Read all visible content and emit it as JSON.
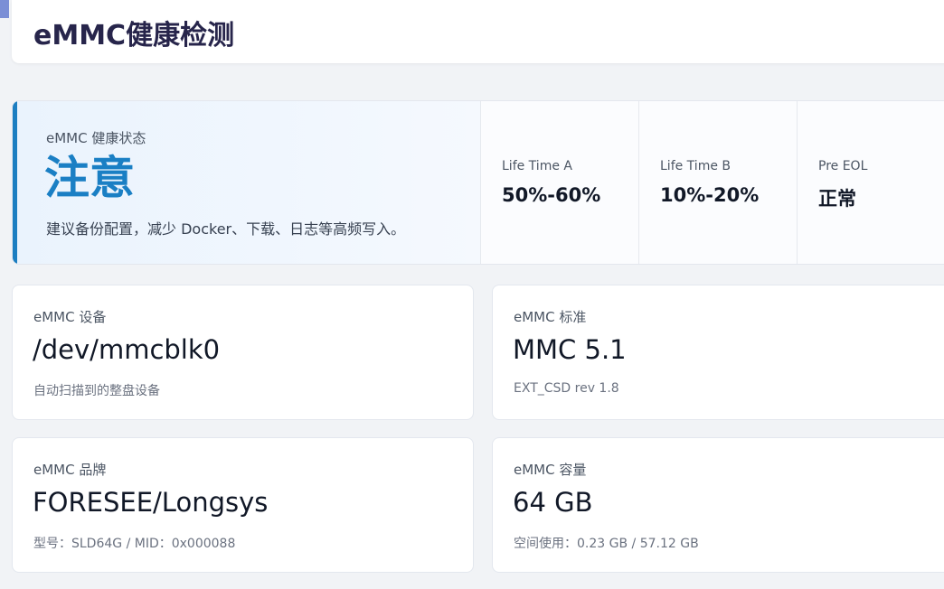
{
  "header": {
    "title": "eMMC健康检测"
  },
  "status": {
    "label": "eMMC 健康状态",
    "value": "注意",
    "description": "建议备份配置，减少 Docker、下载、日志等高频写入。",
    "metrics": [
      {
        "label": "Life Time A",
        "value": "50%-60%"
      },
      {
        "label": "Life Time B",
        "value": "10%-20%"
      },
      {
        "label": "Pre EOL",
        "value": "正常"
      }
    ]
  },
  "cards": [
    {
      "label": "eMMC 设备",
      "value": "/dev/mmcblk0",
      "sub": "自动扫描到的整盘设备"
    },
    {
      "label": "eMMC 标准",
      "value": "MMC 5.1",
      "sub": "EXT_CSD rev 1.8"
    },
    {
      "label": "eMMC 品牌",
      "value": "FORESEE/Longsys",
      "sub": "型号：SLD64G / MID：0x000088"
    },
    {
      "label": "eMMC 容量",
      "value": "64 GB",
      "sub": "空间使用：0.23 GB / 57.12 GB"
    }
  ],
  "colors": {
    "accent": "#1a7fc4",
    "title": "#27254b"
  }
}
